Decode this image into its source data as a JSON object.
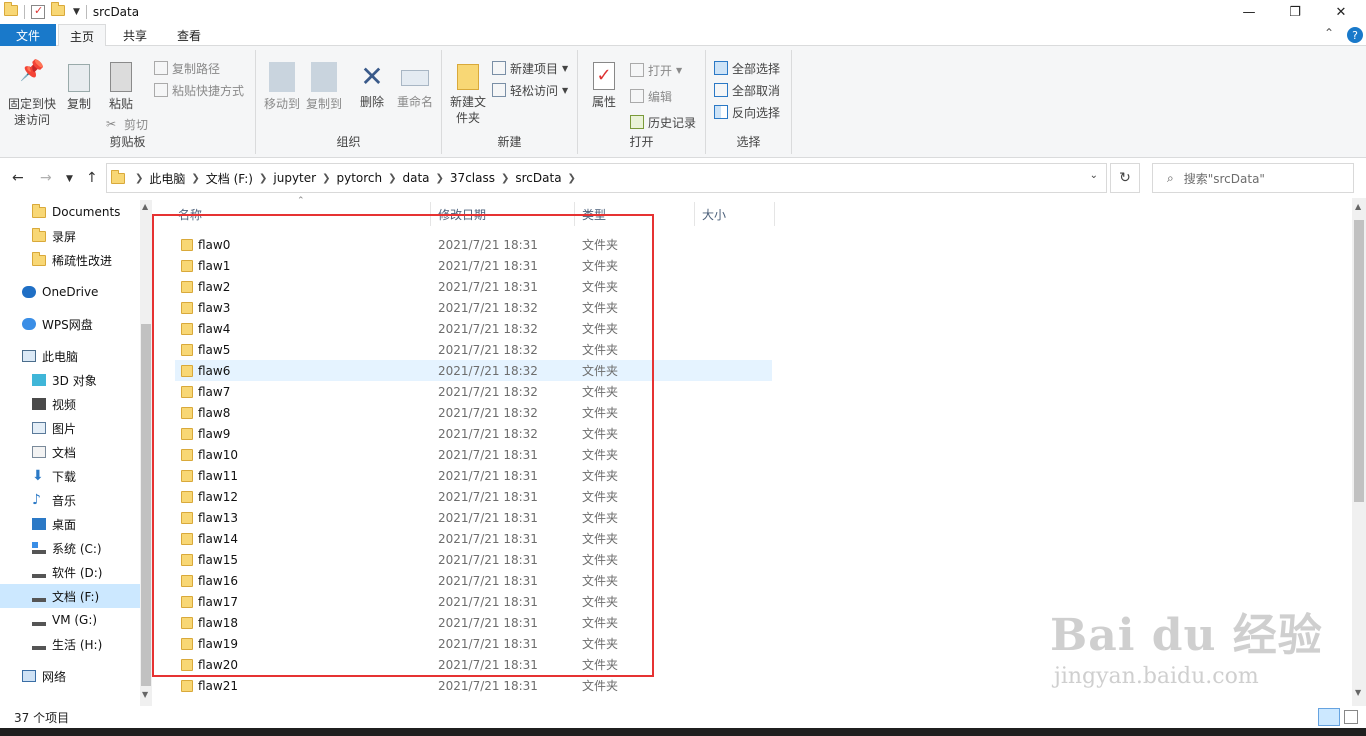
{
  "window": {
    "title": "srcData",
    "minimize_glyph": "—",
    "restore_glyph": "❐",
    "close_glyph": "✕"
  },
  "menu": {
    "file": "文件",
    "tabs": [
      "主页",
      "共享",
      "查看"
    ],
    "active_tab": "主页",
    "collapse_glyph": "⌃",
    "help_glyph": "?"
  },
  "ribbon": {
    "clipboard": {
      "pin": "固定到快速访问",
      "copy": "复制",
      "paste": "粘贴",
      "copy_path": "复制路径",
      "paste_shortcut": "粘贴快捷方式",
      "cut": "剪切",
      "label": "剪贴板"
    },
    "organize": {
      "move_to": "移动到",
      "copy_to": "复制到",
      "delete": "删除",
      "rename": "重命名",
      "label": "组织"
    },
    "new": {
      "new_folder": "新建文件夹",
      "new_item": "新建项目",
      "easy_access": "轻松访问",
      "label": "新建"
    },
    "open": {
      "properties": "属性",
      "open": "打开",
      "edit": "编辑",
      "history": "历史记录",
      "label": "打开"
    },
    "select": {
      "select_all": "全部选择",
      "select_none": "全部取消",
      "invert": "反向选择",
      "label": "选择"
    }
  },
  "address": {
    "crumbs": [
      "此电脑",
      "文档 (F:)",
      "jupyter",
      "pytorch",
      "data",
      "37class",
      "srcData"
    ],
    "search_placeholder": "搜索\"srcData\""
  },
  "nav": {
    "quick": [
      "Documents",
      "录屏",
      "稀疏性改进"
    ],
    "onedrive": "OneDrive",
    "wps": "WPS网盘",
    "thispc": "此电脑",
    "pc_items": [
      "3D 对象",
      "视频",
      "图片",
      "文档",
      "下载",
      "音乐",
      "桌面",
      "系统 (C:)",
      "软件 (D:)",
      "文档 (F:)",
      "VM (G:)",
      "生活 (H:)"
    ],
    "selected": "文档 (F:)",
    "network": "网络"
  },
  "columns": {
    "name": "名称",
    "date": "修改日期",
    "type": "类型",
    "size": "大小"
  },
  "files": [
    {
      "name": "flaw0",
      "date": "2021/7/21 18:31",
      "type": "文件夹"
    },
    {
      "name": "flaw1",
      "date": "2021/7/21 18:31",
      "type": "文件夹"
    },
    {
      "name": "flaw2",
      "date": "2021/7/21 18:31",
      "type": "文件夹"
    },
    {
      "name": "flaw3",
      "date": "2021/7/21 18:32",
      "type": "文件夹"
    },
    {
      "name": "flaw4",
      "date": "2021/7/21 18:32",
      "type": "文件夹"
    },
    {
      "name": "flaw5",
      "date": "2021/7/21 18:32",
      "type": "文件夹"
    },
    {
      "name": "flaw6",
      "date": "2021/7/21 18:32",
      "type": "文件夹"
    },
    {
      "name": "flaw7",
      "date": "2021/7/21 18:32",
      "type": "文件夹"
    },
    {
      "name": "flaw8",
      "date": "2021/7/21 18:32",
      "type": "文件夹"
    },
    {
      "name": "flaw9",
      "date": "2021/7/21 18:32",
      "type": "文件夹"
    },
    {
      "name": "flaw10",
      "date": "2021/7/21 18:31",
      "type": "文件夹"
    },
    {
      "name": "flaw11",
      "date": "2021/7/21 18:31",
      "type": "文件夹"
    },
    {
      "name": "flaw12",
      "date": "2021/7/21 18:31",
      "type": "文件夹"
    },
    {
      "name": "flaw13",
      "date": "2021/7/21 18:31",
      "type": "文件夹"
    },
    {
      "name": "flaw14",
      "date": "2021/7/21 18:31",
      "type": "文件夹"
    },
    {
      "name": "flaw15",
      "date": "2021/7/21 18:31",
      "type": "文件夹"
    },
    {
      "name": "flaw16",
      "date": "2021/7/21 18:31",
      "type": "文件夹"
    },
    {
      "name": "flaw17",
      "date": "2021/7/21 18:31",
      "type": "文件夹"
    },
    {
      "name": "flaw18",
      "date": "2021/7/21 18:31",
      "type": "文件夹"
    },
    {
      "name": "flaw19",
      "date": "2021/7/21 18:31",
      "type": "文件夹"
    },
    {
      "name": "flaw20",
      "date": "2021/7/21 18:31",
      "type": "文件夹"
    },
    {
      "name": "flaw21",
      "date": "2021/7/21 18:31",
      "type": "文件夹"
    }
  ],
  "hovered_file": "flaw6",
  "status": {
    "count": "37 个项目"
  },
  "watermark": {
    "brand": "Bai du 经验",
    "url": "jingyan.baidu.com"
  },
  "colors": {
    "accent": "#1979ca",
    "highlight_box": "#e63232",
    "selection": "#cce8ff",
    "hover": "#e5f3ff"
  }
}
